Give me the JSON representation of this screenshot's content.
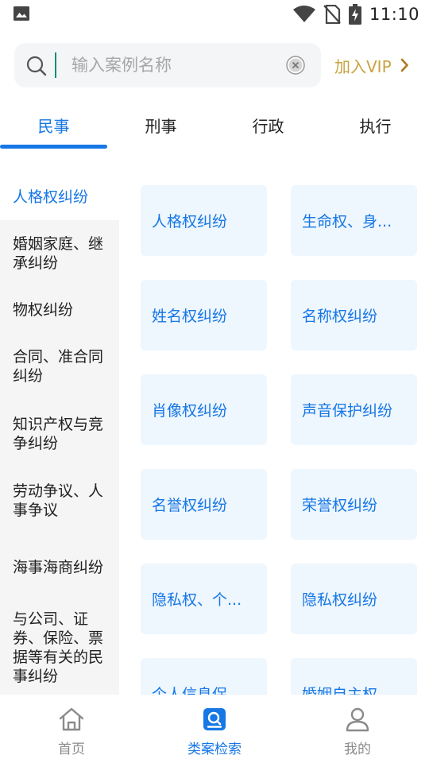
{
  "status_bar": {
    "time": "11:10",
    "icons": [
      "image-icon",
      "wifi-icon",
      "no-sim-icon",
      "battery-charging-icon"
    ]
  },
  "search": {
    "placeholder": "输入案例名称",
    "value": ""
  },
  "vip": {
    "label": "加入VIP"
  },
  "tabs": [
    {
      "label": "民事",
      "active": true
    },
    {
      "label": "刑事",
      "active": false
    },
    {
      "label": "行政",
      "active": false
    },
    {
      "label": "执行",
      "active": false
    }
  ],
  "categories": [
    {
      "label": "人格权纠纷",
      "active": true
    },
    {
      "label": "婚姻家庭、继承纠纷",
      "active": false
    },
    {
      "label": "物权纠纷",
      "active": false
    },
    {
      "label": "合同、准合同纠纷",
      "active": false
    },
    {
      "label": "知识产权与竞争纠纷",
      "active": false
    },
    {
      "label": "劳动争议、人事争议",
      "active": false
    },
    {
      "label": "海事海商纠纷",
      "active": false
    },
    {
      "label": "与公司、证券、保险、票据等有关的民事纠纷",
      "active": false
    }
  ],
  "subcategories": [
    {
      "label": "人格权纠纷"
    },
    {
      "label": "生命权、身..."
    },
    {
      "label": "姓名权纠纷"
    },
    {
      "label": "名称权纠纷"
    },
    {
      "label": "肖像权纠纷"
    },
    {
      "label": "声音保护纠纷"
    },
    {
      "label": "名誉权纠纷"
    },
    {
      "label": "荣誉权纠纷"
    },
    {
      "label": "隐私权、个..."
    },
    {
      "label": "隐私权纠纷"
    },
    {
      "label": "个人信息保"
    },
    {
      "label": "婚姻自主权"
    }
  ],
  "bottom_nav": [
    {
      "label": "首页",
      "icon": "home-icon",
      "active": false
    },
    {
      "label": "类案检索",
      "icon": "case-search-icon",
      "active": true
    },
    {
      "label": "我的",
      "icon": "profile-icon",
      "active": false
    }
  ],
  "colors": {
    "accent": "#1677e5",
    "vip": "#c9a33f",
    "card_bg": "#eef6fe",
    "sidebar_bg": "#f5f5f5"
  }
}
